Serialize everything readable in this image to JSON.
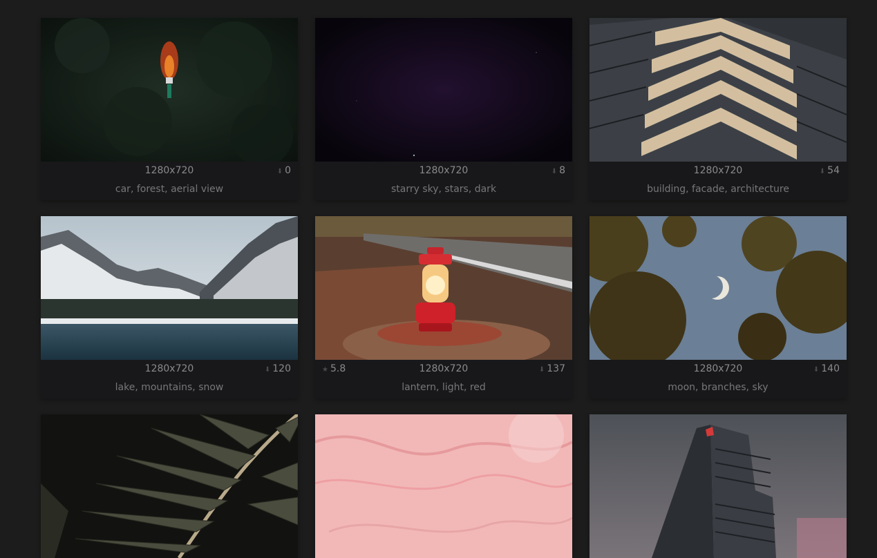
{
  "wallpapers": [
    {
      "resolution": "1280x720",
      "downloads": "0",
      "tags": "car, forest, aerial view",
      "image": "car-forest-aerial-photo"
    },
    {
      "resolution": "1280x720",
      "downloads": "8",
      "tags": "starry sky, stars, dark",
      "image": "dark-starry-sky-photo"
    },
    {
      "resolution": "1280x720",
      "downloads": "54",
      "tags": "building, facade, architecture",
      "image": "building-facade-photo"
    },
    {
      "resolution": "1280x720",
      "downloads": "120",
      "tags": "lake, mountains, snow",
      "image": "lake-mountains-snow-photo"
    },
    {
      "resolution": "1280x720",
      "downloads": "137",
      "rating": "5.8",
      "tags": "lantern, light, red",
      "image": "red-lantern-photo"
    },
    {
      "resolution": "1280x720",
      "downloads": "140",
      "tags": "moon, branches, sky",
      "image": "moon-branches-photo"
    },
    {
      "image": "palm-leaf-photo"
    },
    {
      "image": "pink-marble-texture-photo"
    },
    {
      "image": "skyscraper-photo"
    }
  ],
  "icons": {
    "download": "download-arrow-icon",
    "rating": "star-icon"
  }
}
